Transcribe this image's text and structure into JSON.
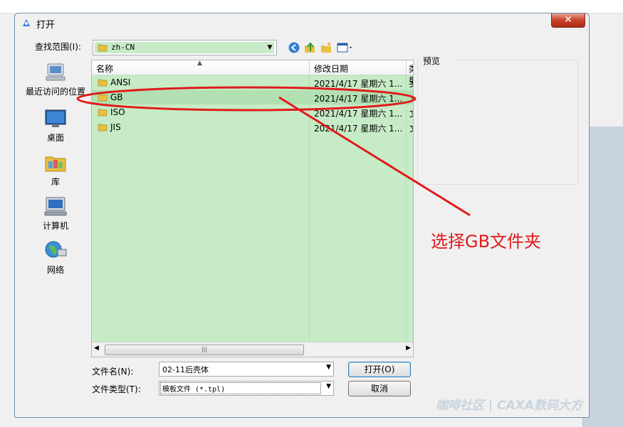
{
  "window": {
    "title": "打开",
    "close_symbol": "✕"
  },
  "lookin": {
    "label": "查找范围(I):",
    "value": "zh-CN"
  },
  "places": [
    {
      "label": "最近访问的位置",
      "icon": "recent-places-icon"
    },
    {
      "label": "桌面",
      "icon": "desktop-icon"
    },
    {
      "label": "库",
      "icon": "library-icon"
    },
    {
      "label": "计算机",
      "icon": "computer-icon"
    },
    {
      "label": "网络",
      "icon": "network-icon"
    }
  ],
  "columns": {
    "name": "名称",
    "date": "修改日期",
    "type": "类型"
  },
  "files": [
    {
      "name": "ANSI",
      "date": "2021/4/17 星期六 1...",
      "type": "文"
    },
    {
      "name": "GB",
      "date": "2021/4/17 星期六 1...",
      "type": "文"
    },
    {
      "name": "ISO",
      "date": "2021/4/17 星期六 1...",
      "type": "文"
    },
    {
      "name": "JIS",
      "date": "2021/4/17 星期六 1...",
      "type": "文"
    }
  ],
  "preview": {
    "label": "预览"
  },
  "filename": {
    "label": "文件名(N):",
    "value": "02-11后壳体"
  },
  "filetype": {
    "label": "文件类型(T):",
    "value": "模板文件 (*.tpl)"
  },
  "buttons": {
    "open": "打开(O)",
    "cancel": "取消"
  },
  "annotation": {
    "text": "选择GB文件夹",
    "color": "#e01b1b"
  },
  "watermark": {
    "text": "咖啡社区 | CAXA数码大方"
  },
  "colors": {
    "list_background": "#c6ebc6",
    "annotation": "#e01b1b"
  }
}
